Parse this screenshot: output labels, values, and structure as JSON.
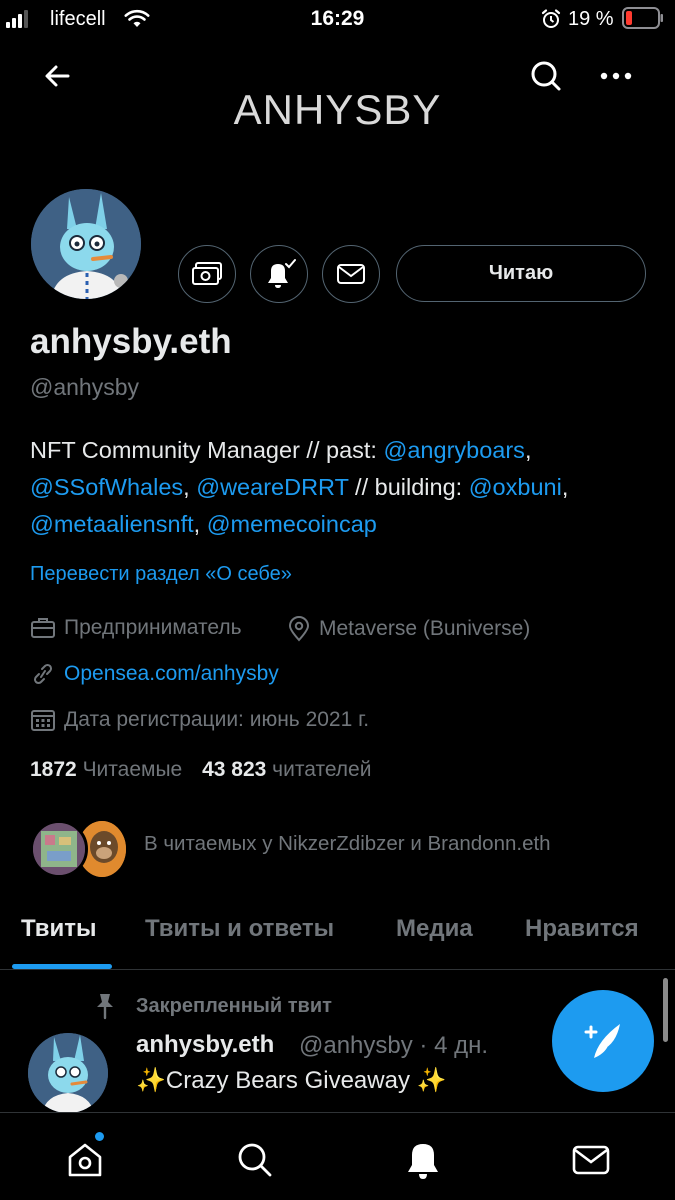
{
  "status_bar": {
    "carrier": "lifecell",
    "time": "16:29",
    "battery": "19 %"
  },
  "header": {
    "title": "ANHYSBY"
  },
  "profile": {
    "display_name": "anhysby.eth",
    "handle": "@anhysby",
    "follow_button": "Читаю",
    "bio_prefix": "NFT Community Manager // past: ",
    "bio_mention_1": "@angryboars",
    "bio_sep_1": ",",
    "bio_mention_2": "@SSofWhales",
    "bio_sep_2": ", ",
    "bio_mention_3": "@weareDRRT",
    "bio_middle": " // building: ",
    "bio_mention_4": "@oxbuni",
    "bio_sep_3": ",",
    "bio_mention_5": "@metaaliensnft",
    "bio_sep_4": ", ",
    "bio_mention_6": "@memecoincap",
    "translate_link": "Перевести раздел «О себе»",
    "profession": "Предприниматель",
    "location": "Metaverse (Buniverse)",
    "website": "Opensea.com/anhysby",
    "joined": "Дата регистрации: июнь 2021 г.",
    "following_count": "1872",
    "following_label": "Читаемые",
    "followers_count": "43 823",
    "followers_label": "читателей",
    "followed_by": "В читаемых у NikzerZdibzer и Brandonn.eth"
  },
  "tabs": [
    {
      "label": "Твиты",
      "active": true
    },
    {
      "label": "Твиты и ответы",
      "active": false
    },
    {
      "label": "Медиа",
      "active": false
    },
    {
      "label": "Нравится",
      "active": false
    }
  ],
  "pinned_tweet": {
    "pinned_label": "Закрепленный твит",
    "name": "anhysby.eth",
    "handle_time": "@anhysby · 4 дн.",
    "text": "✨Crazy Bears Giveaway ✨"
  },
  "colors": {
    "accent": "#1d9bf0",
    "background": "#000000",
    "secondary_text": "#71767b"
  }
}
